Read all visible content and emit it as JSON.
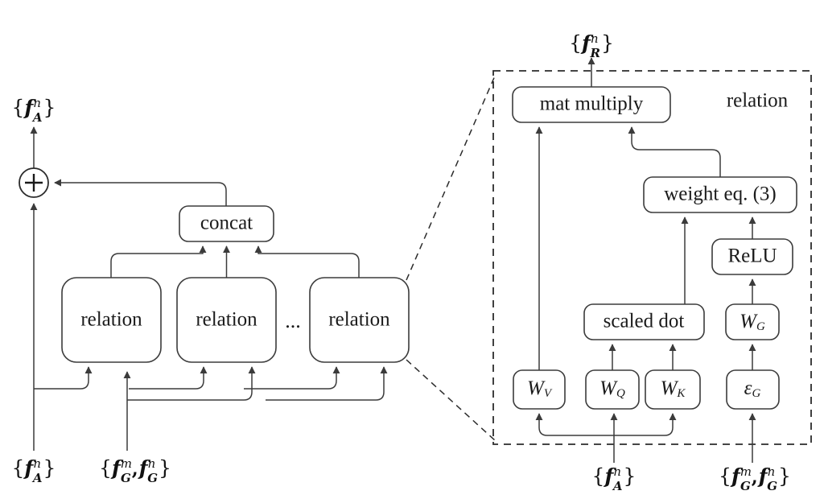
{
  "figure": {
    "kind": "object-relation-module-architecture-diagram",
    "background_color": "#ffffff",
    "stroke_color": "#3b3b3b",
    "text_color": "#1a1a1a"
  },
  "left_panel": {
    "output_label": "{fAn}",
    "output_label_parts": {
      "open": "{",
      "symbol": "f",
      "sup": "n",
      "sub": "A",
      "close": "}"
    },
    "sum_operator": "+",
    "concat_box": {
      "label": "concat"
    },
    "relation_boxes": [
      {
        "label": "relation"
      },
      {
        "label": "relation"
      },
      {
        "label": "relation"
      }
    ],
    "ellipsis": "...",
    "inputs": [
      {
        "label": "{fAn}",
        "parts": {
          "open": "{",
          "symbol": "f",
          "sup": "n",
          "sub": "A",
          "close": "}"
        }
      },
      {
        "label": "{fGm, fGn}",
        "parts": {
          "open": "{",
          "symbol1": "f",
          "sup1": "m",
          "sub1": "G",
          "comma": ",",
          "symbol2": "f",
          "sup2": "n",
          "sub2": "G",
          "close": "}"
        }
      }
    ]
  },
  "right_panel": {
    "region_title": "relation",
    "region_border_style": "dashed",
    "output_label": "{fRn}",
    "output_label_parts": {
      "open": "{",
      "symbol": "f",
      "sup": "n",
      "sub": "R",
      "close": "}"
    },
    "boxes": [
      {
        "id": "mat-multiply",
        "label": "mat multiply"
      },
      {
        "id": "weight-eq-3",
        "label": "weight eq. (3)"
      },
      {
        "id": "relu",
        "label": "ReLU"
      },
      {
        "id": "scaled-dot",
        "label": "scaled dot"
      },
      {
        "id": "w-g",
        "label": "WG",
        "base": "W",
        "sub": "G"
      },
      {
        "id": "w-v",
        "label": "WV",
        "base": "W",
        "sub": "V"
      },
      {
        "id": "w-q",
        "label": "WQ",
        "base": "W",
        "sub": "Q"
      },
      {
        "id": "w-k",
        "label": "WK",
        "base": "W",
        "sub": "K"
      },
      {
        "id": "eps-g",
        "label": "εG",
        "base": "ε",
        "sub": "G"
      }
    ],
    "inputs": [
      {
        "label": "{fAn}",
        "parts": {
          "open": "{",
          "symbol": "f",
          "sup": "n",
          "sub": "A",
          "close": "}"
        }
      },
      {
        "label": "{fGm, fGn}",
        "parts": {
          "open": "{",
          "symbol1": "f",
          "sup1": "m",
          "sub1": "G",
          "comma": ",",
          "symbol2": "f",
          "sup2": "n",
          "sub2": "G",
          "close": "}"
        }
      }
    ]
  }
}
